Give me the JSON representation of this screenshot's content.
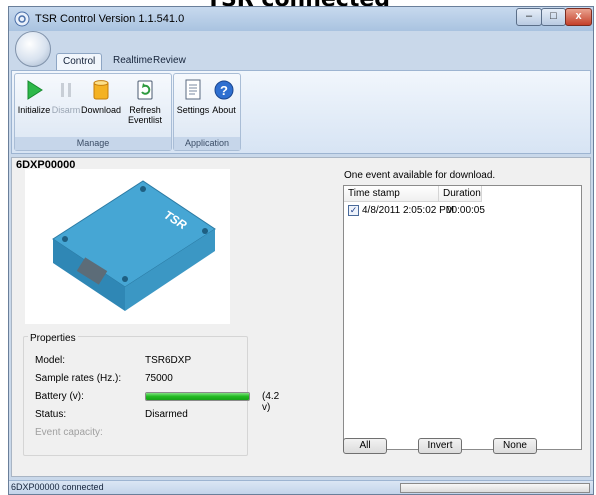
{
  "caption": "TSR connected",
  "window": {
    "title": "TSR Control Version 1.1.541.0",
    "controls": {
      "minimize": "–",
      "maximize": "□",
      "close": "x"
    }
  },
  "tabs": [
    {
      "label": "Control",
      "active": true
    },
    {
      "label": "Realtime",
      "active": false
    },
    {
      "label": "Review",
      "active": false
    }
  ],
  "ribbon": {
    "manage": {
      "label": "Manage",
      "initialize": "Initialize",
      "disarm": "Disarm",
      "download": "Download",
      "refresh_line1": "Refresh",
      "refresh_line2": "Eventlist"
    },
    "application": {
      "label": "Application",
      "settings": "Settings",
      "about": "About"
    }
  },
  "device": {
    "name": "6DXP00000",
    "photo_label": "TSR"
  },
  "properties": {
    "title": "Properties",
    "model_label": "Model:",
    "model_value": "TSR6DXP",
    "sample_label": "Sample rates (Hz.):",
    "sample_value": "75000",
    "battery_label": "Battery (v):",
    "battery_value": "(4.2 v)",
    "battery_fraction": 1.0,
    "status_label": "Status:",
    "status_value": "Disarmed",
    "capacity_label": "Event capacity:"
  },
  "events": {
    "available_text": "One event available for download.",
    "columns": [
      "Time stamp",
      "Duration"
    ],
    "rows": [
      {
        "checked": true,
        "timestamp": "4/8/2011 2:05:02 PM",
        "duration": "00:00:05"
      }
    ]
  },
  "buttons": {
    "all": "All",
    "invert": "Invert",
    "none": "None"
  },
  "statusbar": {
    "text": "6DXP00000 connected"
  },
  "colors": {
    "ribbon_bg": "#dbe6f4",
    "battery_green": "#1fba1f",
    "titlebar": "#b9cfe8",
    "close_red": "#c4402a"
  }
}
